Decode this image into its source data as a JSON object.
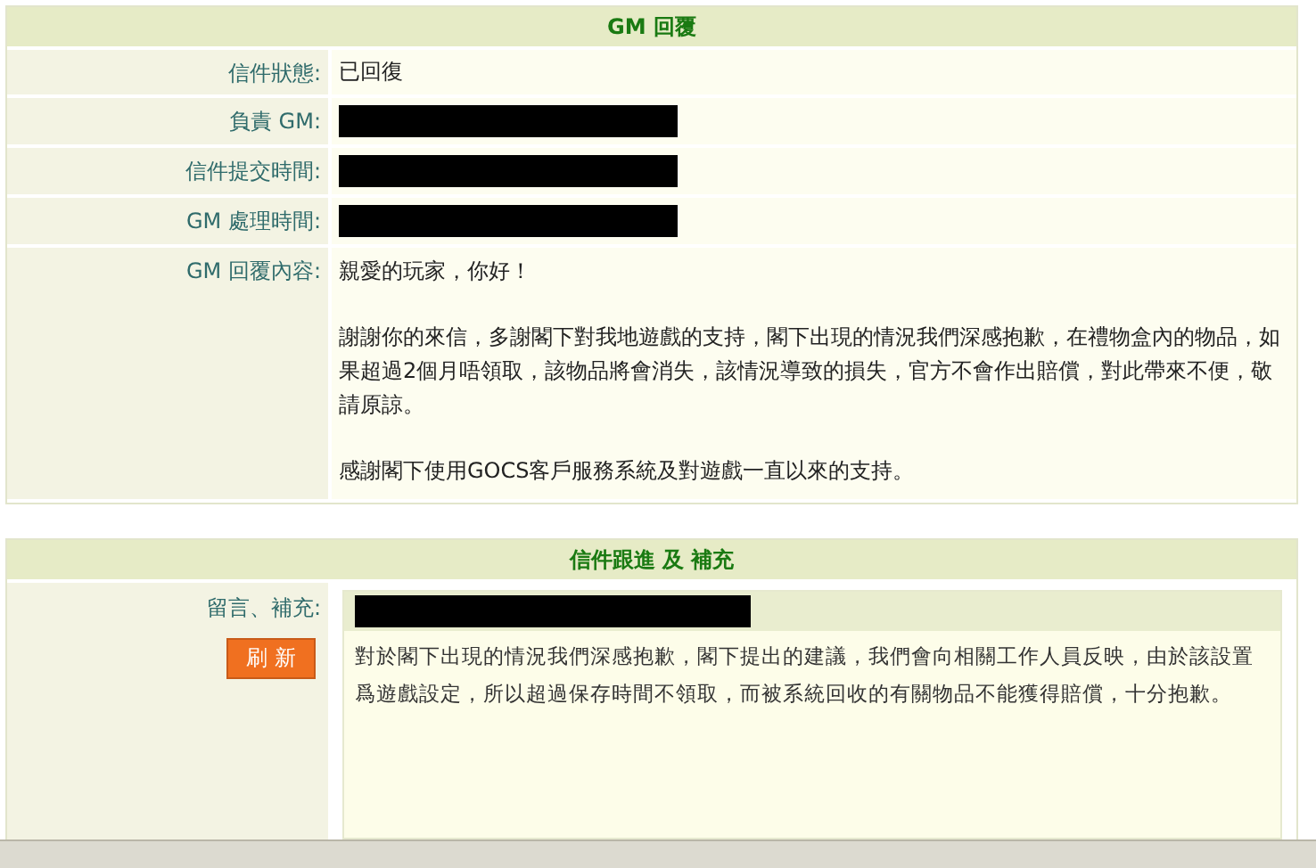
{
  "reply_panel": {
    "title": "GM 回覆",
    "fields": [
      {
        "label": "信件狀態:",
        "kind": "text",
        "value": "已回復"
      },
      {
        "label": "負責 GM:",
        "kind": "redacted"
      },
      {
        "label": "信件提交時間:",
        "kind": "redacted"
      },
      {
        "label": "GM 處理時間:",
        "kind": "redacted"
      },
      {
        "label": "GM 回覆內容:",
        "kind": "paragraphs",
        "paragraphs": [
          "親愛的玩家，你好！",
          "謝謝你的來信，多謝閣下對我地遊戲的支持，閣下出現的情況我們深感抱歉，在禮物盒內的物品，如果超過2個月唔領取，該物品將會消失，該情況導致的損失，官方不會作出賠償，對此帶來不便，敬請原諒。",
          "感謝閣下使用GOCS客戶服務系統及對遊戲一直以來的支持。"
        ]
      }
    ]
  },
  "followup_panel": {
    "title": "信件跟進 及 補充",
    "label": "留言、補充:",
    "refresh_button": "刷 新",
    "messages": [
      {
        "text": "對於閣下出現的情況我們深感抱歉，閣下提出的建議，我們會向相關工作人員反映，由於該設置爲遊戲設定，所以超過保存時間不領取，而被系統回收的有關物品不能獲得賠償，十分抱歉。"
      }
    ]
  }
}
